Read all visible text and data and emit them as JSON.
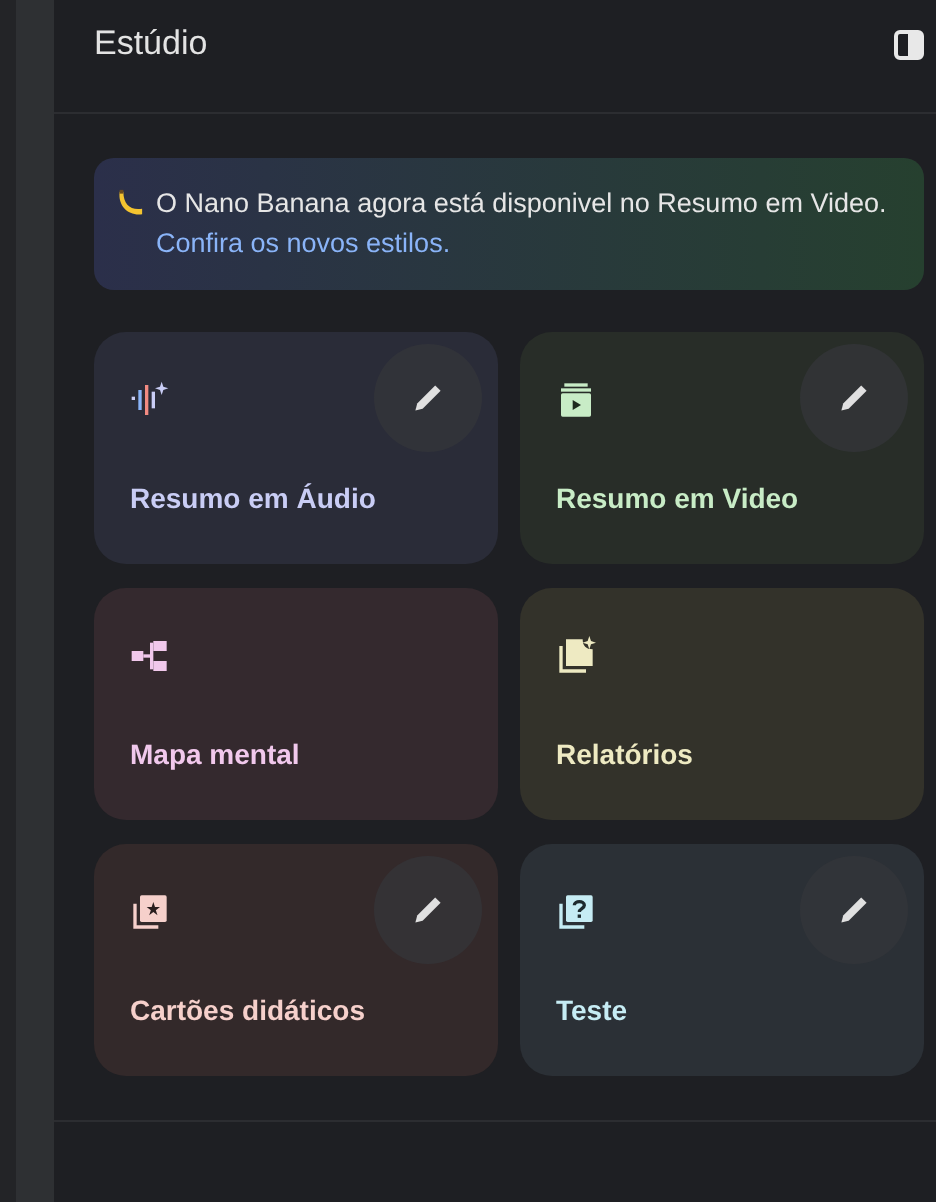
{
  "panel": {
    "title": "Estúdio"
  },
  "banner": {
    "text": "O Nano Banana agora está disponivel no Resumo em Video.",
    "link": "Confira os novos estilos."
  },
  "tiles": [
    {
      "kind": "audio",
      "label": "Resumo em Áudio",
      "color": "#c9cdf5",
      "editable": true
    },
    {
      "kind": "video",
      "label": "Resumo em Video",
      "color": "#c8ecc6",
      "editable": true
    },
    {
      "kind": "mindmap",
      "label": "Mapa mental",
      "color": "#f1c8ec",
      "editable": false
    },
    {
      "kind": "reports",
      "label": "Relatórios",
      "color": "#eeeac2",
      "editable": false
    },
    {
      "kind": "flashcards",
      "label": "Cartões didáticos",
      "color": "#f6d0cb",
      "editable": true
    },
    {
      "kind": "quiz",
      "label": "Teste",
      "color": "#c6ecf4",
      "editable": true
    }
  ]
}
